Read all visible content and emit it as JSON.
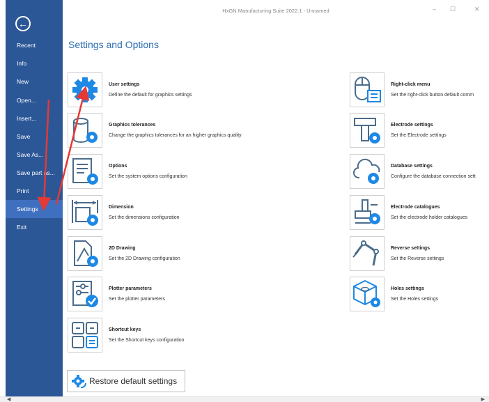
{
  "window": {
    "title": "HxGN Manufacturing Suite 2022.1 - Unnamed",
    "minimize_glyph": "–",
    "maximize_glyph": "☐",
    "close_glyph": "✕"
  },
  "sidebar": {
    "back_icon": "arrow-left-circle-icon",
    "items": [
      {
        "label": "Recent"
      },
      {
        "label": "Info"
      },
      {
        "label": "New"
      },
      {
        "label": "Open..."
      },
      {
        "label": "Insert..."
      },
      {
        "label": "Save"
      },
      {
        "label": "Save As..."
      },
      {
        "label": "Save part as..."
      },
      {
        "label": "Print"
      },
      {
        "label": "Settings",
        "active": true
      },
      {
        "label": "Exit"
      }
    ]
  },
  "main": {
    "title": "Settings and Options",
    "left_options": [
      {
        "title": "User settings",
        "desc": "Define the default for graphics settings",
        "icon": "gear-icon"
      },
      {
        "title": "Graphics tolerances",
        "desc": "Change the graphics tolerances for an higher graphics quality",
        "icon": "cylinder-gear-icon"
      },
      {
        "title": "Options",
        "desc": "Set the system options configuration",
        "icon": "document-gear-icon"
      },
      {
        "title": "Dimension",
        "desc": "Set the dimensions configuration",
        "icon": "dimension-gear-icon"
      },
      {
        "title": "2D Drawing",
        "desc": "Set the 2D Drawing configuration",
        "icon": "drawing-gear-icon"
      },
      {
        "title": "Plotter parameters",
        "desc": "Set the plotter parameters",
        "icon": "sliders-check-icon"
      },
      {
        "title": "Shortcut keys",
        "desc": "Set the Shortcut keys configuration",
        "icon": "keys-icon"
      }
    ],
    "right_options": [
      {
        "title": "Right-click menu",
        "desc": "Set the right-click button default comm",
        "icon": "mouse-menu-icon"
      },
      {
        "title": "Electrode settings",
        "desc": "Set the Electrode settings",
        "icon": "electrode-gear-icon"
      },
      {
        "title": "Database settings",
        "desc": "Configure the database connection sett",
        "icon": "cloud-gear-icon"
      },
      {
        "title": "Electrode catalogues",
        "desc": "Set the electrode holder catalogues",
        "icon": "catalogue-gear-icon"
      },
      {
        "title": "Reverse settings",
        "desc": "Set the Reverse settings",
        "icon": "robot-arm-icon"
      },
      {
        "title": "Holes settings",
        "desc": "Set the Holes settings",
        "icon": "cube-gear-icon"
      }
    ],
    "restore_label": "Restore default settings"
  },
  "colors": {
    "sidebar_bg": "#2b5797",
    "sidebar_active": "#3f6fbf",
    "accent": "#2b6cb0",
    "icon_blue": "#1e88e5",
    "arrow_red": "#e53935"
  }
}
